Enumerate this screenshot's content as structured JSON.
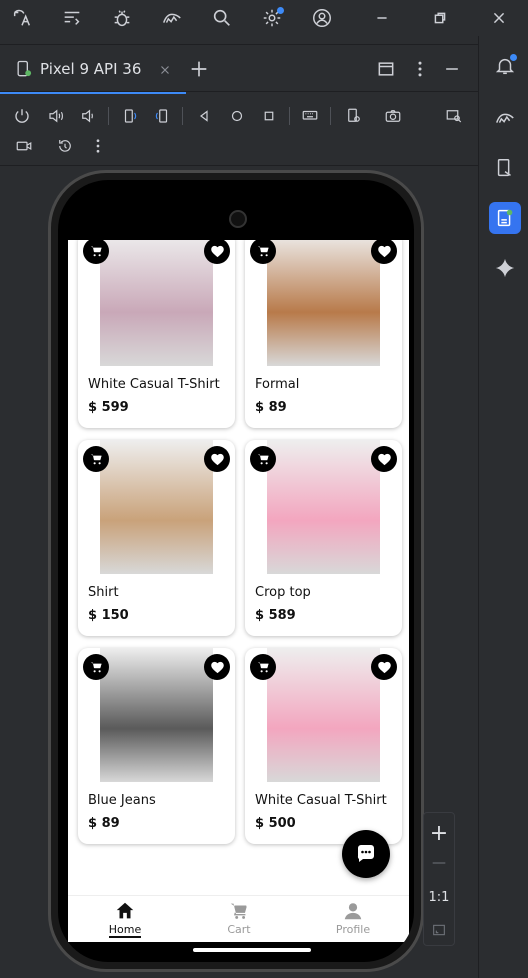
{
  "ide": {
    "device_tab": {
      "title": "Pixel 9 API 36"
    },
    "zoom": {
      "plus": "+",
      "minus": "—",
      "ratio": "1:1"
    }
  },
  "app": {
    "products": [
      {
        "name": "White Casual T-Shirt",
        "price": "$ 599",
        "photo_color": "#c9a8b8"
      },
      {
        "name": "Formal",
        "price": "$ 89",
        "photo_color": "#b87a4a"
      },
      {
        "name": "Shirt",
        "price": "$ 150",
        "photo_color": "#c9a27a"
      },
      {
        "name": "Crop top",
        "price": "$ 589",
        "photo_color": "#f3a6bf"
      },
      {
        "name": "Blue Jeans",
        "price": "$ 89",
        "photo_color": "#5a5a5a"
      },
      {
        "name": "White Casual T-Shirt",
        "price": "$ 500",
        "photo_color": "#f3a6bf"
      }
    ],
    "nav": [
      {
        "label": "Home",
        "icon": "home-icon",
        "active": true
      },
      {
        "label": "Cart",
        "icon": "cart-icon",
        "active": false
      },
      {
        "label": "Profile",
        "icon": "person-icon",
        "active": false
      }
    ]
  },
  "colors": {
    "ide_bg": "#2b2d30",
    "accent": "#3d8af7",
    "icon": "#ced0d6"
  }
}
